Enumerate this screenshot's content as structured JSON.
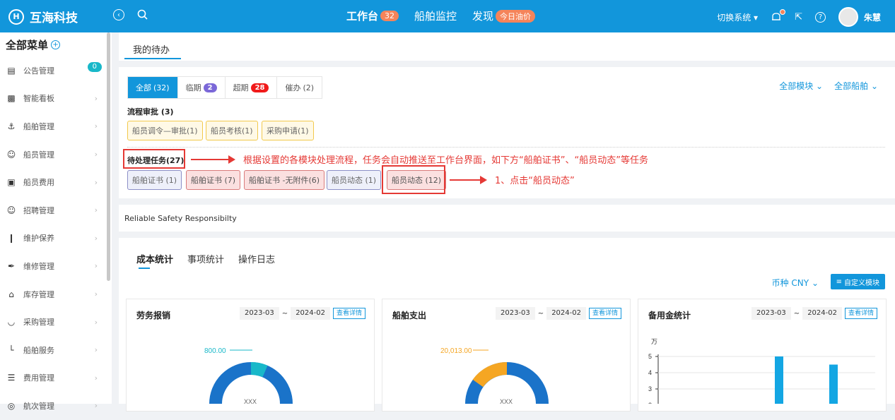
{
  "app": {
    "name": "互海科技",
    "logo_letter": "H"
  },
  "topnav": {
    "items": [
      {
        "label": "工作台",
        "badge": "32"
      },
      {
        "label": "船舶监控"
      },
      {
        "label": "发现",
        "badge": "今日油价"
      }
    ],
    "switch_system": "切换系统",
    "user_name": "朱慧"
  },
  "sidebar": {
    "title": "全部菜单",
    "items": [
      {
        "label": "公告管理",
        "icon": "book-icon",
        "badge": "0"
      },
      {
        "label": "智能看板",
        "icon": "dashboard-icon"
      },
      {
        "label": "船舶管理",
        "icon": "anchor-icon"
      },
      {
        "label": "船员管理",
        "icon": "person-icon"
      },
      {
        "label": "船员费用",
        "icon": "wallet-icon"
      },
      {
        "label": "招聘管理",
        "icon": "person-icon"
      },
      {
        "label": "维护保养",
        "icon": "wrench-icon"
      },
      {
        "label": "维修管理",
        "icon": "tool-icon"
      },
      {
        "label": "库存管理",
        "icon": "home-icon"
      },
      {
        "label": "采购管理",
        "icon": "cart-icon"
      },
      {
        "label": "船舶服务",
        "icon": "service-icon"
      },
      {
        "label": "费用管理",
        "icon": "database-icon"
      },
      {
        "label": "航次管理",
        "icon": "globe-icon"
      }
    ]
  },
  "page_tab": "我的待办",
  "todo": {
    "filters": [
      {
        "label": "全部",
        "count": "(32)"
      },
      {
        "label": "临期",
        "badge": "2"
      },
      {
        "label": "超期",
        "badge": "28"
      },
      {
        "label": "催办",
        "count": "(2)"
      }
    ],
    "module_dropdown": "全部模块",
    "ship_dropdown": "全部船舶",
    "approval_title": "流程审批 (3)",
    "approval_chips": [
      "船员调令—审批(1)",
      "船员考核(1)",
      "采购申请(1)"
    ],
    "pending_title": "待处理任务(27)",
    "pending_chips": [
      "船舶证书 (1)",
      "船舶证书 (7)",
      "船舶证书 -无附件(6)",
      "船员动态 (1)",
      "船员动态 (12)"
    ]
  },
  "annotations": {
    "note1": "根据设置的各模块处理流程，任务会自动推送至工作台界面，如下方“船舶证书”、“船员动态”等任务",
    "note2": "1、点击“船员动态”"
  },
  "motto": "Reliable Safety Responsibilty",
  "stats": {
    "tabs": [
      "成本统计",
      "事项统计",
      "操作日志"
    ],
    "currency": "币种 CNY",
    "custom_button": "自定义模块",
    "cards": [
      {
        "title": "劳务报销",
        "from": "2023-03",
        "to": "2024-02",
        "detail": "查看详情",
        "value_label": "800.00",
        "stub": "XXX"
      },
      {
        "title": "船舶支出",
        "from": "2023-03",
        "to": "2024-02",
        "detail": "查看详情",
        "value_label": "20,013.00",
        "stub": "XXX"
      },
      {
        "title": "备用金统计",
        "from": "2023-03",
        "to": "2024-02",
        "detail": "查看详情",
        "unit": "万",
        "y_ticks": [
          "5",
          "4",
          "3",
          "2"
        ]
      }
    ]
  },
  "chart_data": {
    "type": "bar",
    "ylabel": "万",
    "ylim": [
      2,
      5
    ],
    "values": [
      5,
      4.5
    ]
  },
  "colors": {
    "primary": "#1296db",
    "accent": "#f5845a",
    "danger": "#e53935"
  }
}
